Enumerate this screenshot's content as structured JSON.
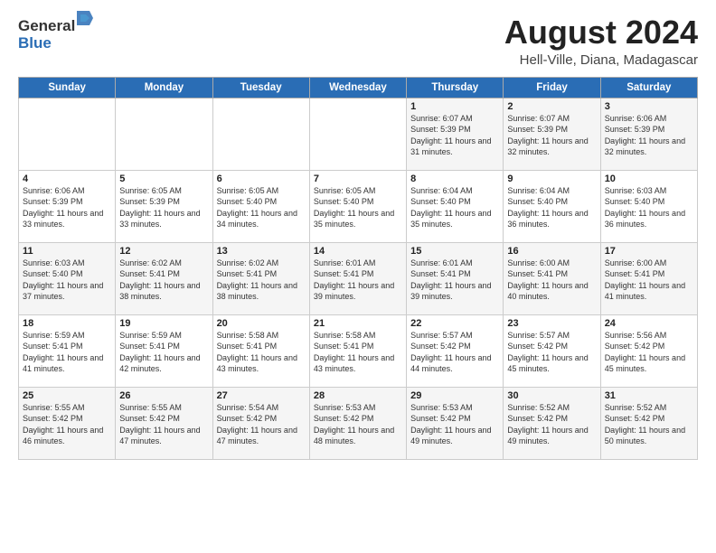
{
  "logo": {
    "general": "General",
    "blue": "Blue"
  },
  "title": "August 2024",
  "location": "Hell-Ville, Diana, Madagascar",
  "days_of_week": [
    "Sunday",
    "Monday",
    "Tuesday",
    "Wednesday",
    "Thursday",
    "Friday",
    "Saturday"
  ],
  "weeks": [
    [
      {
        "day": "",
        "sunrise": "",
        "sunset": "",
        "daylight": ""
      },
      {
        "day": "",
        "sunrise": "",
        "sunset": "",
        "daylight": ""
      },
      {
        "day": "",
        "sunrise": "",
        "sunset": "",
        "daylight": ""
      },
      {
        "day": "",
        "sunrise": "",
        "sunset": "",
        "daylight": ""
      },
      {
        "day": "1",
        "sunrise": "Sunrise: 6:07 AM",
        "sunset": "Sunset: 5:39 PM",
        "daylight": "Daylight: 11 hours and 31 minutes."
      },
      {
        "day": "2",
        "sunrise": "Sunrise: 6:07 AM",
        "sunset": "Sunset: 5:39 PM",
        "daylight": "Daylight: 11 hours and 32 minutes."
      },
      {
        "day": "3",
        "sunrise": "Sunrise: 6:06 AM",
        "sunset": "Sunset: 5:39 PM",
        "daylight": "Daylight: 11 hours and 32 minutes."
      }
    ],
    [
      {
        "day": "4",
        "sunrise": "Sunrise: 6:06 AM",
        "sunset": "Sunset: 5:39 PM",
        "daylight": "Daylight: 11 hours and 33 minutes."
      },
      {
        "day": "5",
        "sunrise": "Sunrise: 6:05 AM",
        "sunset": "Sunset: 5:39 PM",
        "daylight": "Daylight: 11 hours and 33 minutes."
      },
      {
        "day": "6",
        "sunrise": "Sunrise: 6:05 AM",
        "sunset": "Sunset: 5:40 PM",
        "daylight": "Daylight: 11 hours and 34 minutes."
      },
      {
        "day": "7",
        "sunrise": "Sunrise: 6:05 AM",
        "sunset": "Sunset: 5:40 PM",
        "daylight": "Daylight: 11 hours and 35 minutes."
      },
      {
        "day": "8",
        "sunrise": "Sunrise: 6:04 AM",
        "sunset": "Sunset: 5:40 PM",
        "daylight": "Daylight: 11 hours and 35 minutes."
      },
      {
        "day": "9",
        "sunrise": "Sunrise: 6:04 AM",
        "sunset": "Sunset: 5:40 PM",
        "daylight": "Daylight: 11 hours and 36 minutes."
      },
      {
        "day": "10",
        "sunrise": "Sunrise: 6:03 AM",
        "sunset": "Sunset: 5:40 PM",
        "daylight": "Daylight: 11 hours and 36 minutes."
      }
    ],
    [
      {
        "day": "11",
        "sunrise": "Sunrise: 6:03 AM",
        "sunset": "Sunset: 5:40 PM",
        "daylight": "Daylight: 11 hours and 37 minutes."
      },
      {
        "day": "12",
        "sunrise": "Sunrise: 6:02 AM",
        "sunset": "Sunset: 5:41 PM",
        "daylight": "Daylight: 11 hours and 38 minutes."
      },
      {
        "day": "13",
        "sunrise": "Sunrise: 6:02 AM",
        "sunset": "Sunset: 5:41 PM",
        "daylight": "Daylight: 11 hours and 38 minutes."
      },
      {
        "day": "14",
        "sunrise": "Sunrise: 6:01 AM",
        "sunset": "Sunset: 5:41 PM",
        "daylight": "Daylight: 11 hours and 39 minutes."
      },
      {
        "day": "15",
        "sunrise": "Sunrise: 6:01 AM",
        "sunset": "Sunset: 5:41 PM",
        "daylight": "Daylight: 11 hours and 39 minutes."
      },
      {
        "day": "16",
        "sunrise": "Sunrise: 6:00 AM",
        "sunset": "Sunset: 5:41 PM",
        "daylight": "Daylight: 11 hours and 40 minutes."
      },
      {
        "day": "17",
        "sunrise": "Sunrise: 6:00 AM",
        "sunset": "Sunset: 5:41 PM",
        "daylight": "Daylight: 11 hours and 41 minutes."
      }
    ],
    [
      {
        "day": "18",
        "sunrise": "Sunrise: 5:59 AM",
        "sunset": "Sunset: 5:41 PM",
        "daylight": "Daylight: 11 hours and 41 minutes."
      },
      {
        "day": "19",
        "sunrise": "Sunrise: 5:59 AM",
        "sunset": "Sunset: 5:41 PM",
        "daylight": "Daylight: 11 hours and 42 minutes."
      },
      {
        "day": "20",
        "sunrise": "Sunrise: 5:58 AM",
        "sunset": "Sunset: 5:41 PM",
        "daylight": "Daylight: 11 hours and 43 minutes."
      },
      {
        "day": "21",
        "sunrise": "Sunrise: 5:58 AM",
        "sunset": "Sunset: 5:41 PM",
        "daylight": "Daylight: 11 hours and 43 minutes."
      },
      {
        "day": "22",
        "sunrise": "Sunrise: 5:57 AM",
        "sunset": "Sunset: 5:42 PM",
        "daylight": "Daylight: 11 hours and 44 minutes."
      },
      {
        "day": "23",
        "sunrise": "Sunrise: 5:57 AM",
        "sunset": "Sunset: 5:42 PM",
        "daylight": "Daylight: 11 hours and 45 minutes."
      },
      {
        "day": "24",
        "sunrise": "Sunrise: 5:56 AM",
        "sunset": "Sunset: 5:42 PM",
        "daylight": "Daylight: 11 hours and 45 minutes."
      }
    ],
    [
      {
        "day": "25",
        "sunrise": "Sunrise: 5:55 AM",
        "sunset": "Sunset: 5:42 PM",
        "daylight": "Daylight: 11 hours and 46 minutes."
      },
      {
        "day": "26",
        "sunrise": "Sunrise: 5:55 AM",
        "sunset": "Sunset: 5:42 PM",
        "daylight": "Daylight: 11 hours and 47 minutes."
      },
      {
        "day": "27",
        "sunrise": "Sunrise: 5:54 AM",
        "sunset": "Sunset: 5:42 PM",
        "daylight": "Daylight: 11 hours and 47 minutes."
      },
      {
        "day": "28",
        "sunrise": "Sunrise: 5:53 AM",
        "sunset": "Sunset: 5:42 PM",
        "daylight": "Daylight: 11 hours and 48 minutes."
      },
      {
        "day": "29",
        "sunrise": "Sunrise: 5:53 AM",
        "sunset": "Sunset: 5:42 PM",
        "daylight": "Daylight: 11 hours and 49 minutes."
      },
      {
        "day": "30",
        "sunrise": "Sunrise: 5:52 AM",
        "sunset": "Sunset: 5:42 PM",
        "daylight": "Daylight: 11 hours and 49 minutes."
      },
      {
        "day": "31",
        "sunrise": "Sunrise: 5:52 AM",
        "sunset": "Sunset: 5:42 PM",
        "daylight": "Daylight: 11 hours and 50 minutes."
      }
    ]
  ]
}
